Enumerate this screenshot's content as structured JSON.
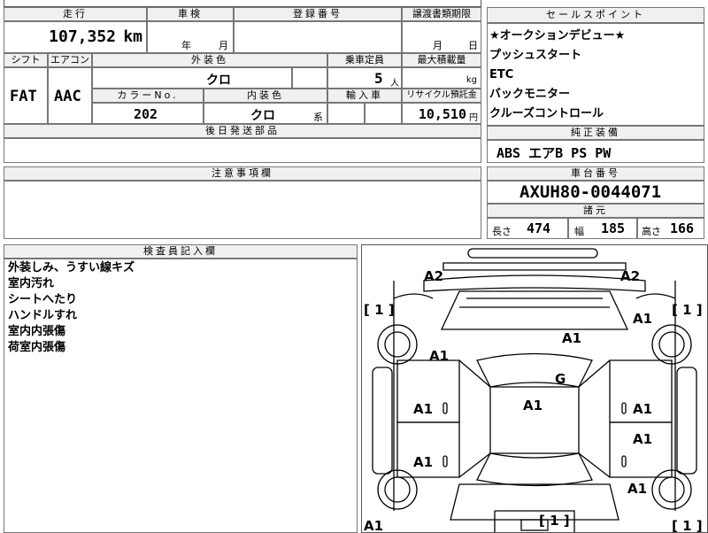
{
  "top": {
    "mileage_header": "走行",
    "mileage_value": "107,352",
    "mileage_unit": "km",
    "inspection_header": "車検",
    "inspection_year": "年",
    "inspection_month": "月",
    "registration_header": "登録番号",
    "transfer_header": "譲渡書類期限",
    "transfer_month": "月",
    "transfer_day": "日"
  },
  "row2": {
    "shift_header": "シフト",
    "shift_value": "FAT",
    "ac_header": "エアコン",
    "ac_value": "AAC",
    "exterior_header": "外装色",
    "exterior_value": "クロ",
    "capacity_header": "乗車定員",
    "capacity_value": "5",
    "capacity_unit": "人",
    "load_header": "最大積載量",
    "load_unit": "kg",
    "color_no_header": "カラーNo.",
    "color_no_value": "202",
    "interior_header": "内装色",
    "interior_value": "クロ",
    "interior_suffix": "系",
    "import_header": "輸入車",
    "recycle_header": "リサイクル預託金",
    "recycle_value": "10,510",
    "recycle_unit": "円"
  },
  "later_parts_header": "後日発送部品",
  "selling_points": {
    "header": "セールスポイント",
    "items": [
      "★オークションデビュー★",
      "プッシュスタート",
      "ETC",
      "バックモニター",
      "クルーズコントロール"
    ]
  },
  "equipment": {
    "header": "純正装備",
    "value": "ABS エアB PS PW"
  },
  "caution_header": "注意事項欄",
  "chassis": {
    "header": "車台番号",
    "value": "AXUH80-0044071"
  },
  "specs": {
    "header": "諸元",
    "length_label": "長さ",
    "length_value": "474",
    "width_label": "幅",
    "width_value": "185",
    "height_label": "高さ",
    "height_value": "166"
  },
  "inspector": {
    "header": "検査員記入欄",
    "notes": [
      "外装しみ、うすい線キズ",
      "室内汚れ",
      "シートへたり",
      "ハンドルすれ",
      "室内内張傷",
      "荷室内張傷"
    ]
  },
  "diagram": {
    "marks": [
      "A2",
      "A2",
      "[ 1 ]",
      "[ 1 ]",
      "A1",
      "A1",
      "A1",
      "G",
      "A1",
      "A1",
      "A1",
      "A1",
      "A1",
      "A1",
      "A1",
      "[ 1 ]",
      "[ 1 ]"
    ]
  }
}
